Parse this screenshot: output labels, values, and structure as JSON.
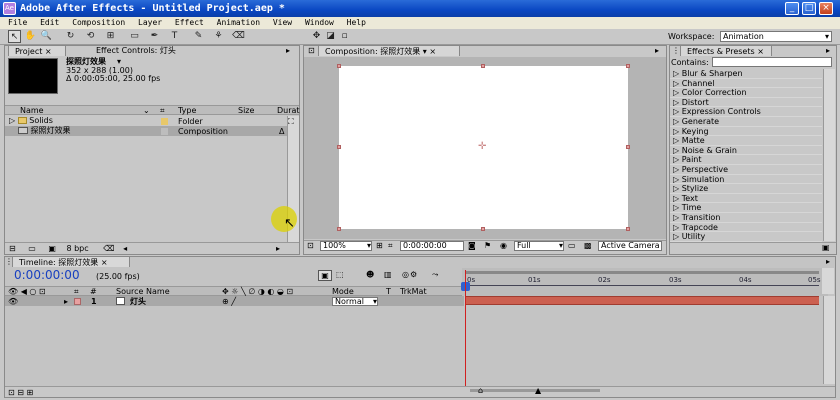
{
  "window": {
    "title": "Adobe After Effects - Untitled Project.aep *",
    "app_icon": "Ae",
    "buttons": {
      "minimize": "_",
      "maximize": "□",
      "close": "×"
    }
  },
  "menu": [
    "File",
    "Edit",
    "Composition",
    "Layer",
    "Effect",
    "Animation",
    "View",
    "Window",
    "Help"
  ],
  "toolbar": {
    "workspace_label": "Workspace:",
    "workspace_value": "Animation",
    "tools": [
      {
        "name": "selection-tool-icon",
        "glyph": "↖"
      },
      {
        "name": "hand-tool-icon",
        "glyph": "✋"
      },
      {
        "name": "zoom-tool-icon",
        "glyph": "🔍"
      },
      {
        "name": "rotate-tool-icon",
        "glyph": "↻"
      },
      {
        "name": "orbit-camera-icon",
        "glyph": "⟲"
      },
      {
        "name": "pan-behind-icon",
        "glyph": "⊞"
      },
      {
        "name": "mask-tool-icon",
        "glyph": "▭"
      },
      {
        "name": "pen-tool-icon",
        "glyph": "✒"
      },
      {
        "name": "type-tool-icon",
        "glyph": "T"
      },
      {
        "name": "brush-tool-icon",
        "glyph": "✎"
      },
      {
        "name": "clone-stamp-icon",
        "glyph": "⚘"
      },
      {
        "name": "eraser-icon",
        "glyph": "⌫"
      }
    ]
  },
  "project": {
    "tab_label": "Project",
    "tab2_label": "Effect Controls: 灯头",
    "item_name": "探照灯效果",
    "item_dims": "352 x 288 (1.00)",
    "item_duration": "Δ 0:00:05:00, 25.00 fps",
    "columns": {
      "name": "Name",
      "type": "Type",
      "size": "Size",
      "duration": "Durat"
    },
    "items": [
      {
        "name": "Solids",
        "type": "Folder",
        "label_color": "#e8c86a"
      },
      {
        "name": "探照灯效果",
        "type": "Composition",
        "label_color": "#bdbdbd",
        "extra": "Δ"
      }
    ],
    "bpc": "8 bpc"
  },
  "composition": {
    "tab_label": "Composition: 探照灯效果",
    "zoom": "100%",
    "timecode": "0:00:00:00",
    "resolution": "Full",
    "camera": "Active Camera",
    "canvas_color": "#ffffff"
  },
  "effects": {
    "tab_label": "Effects & Presets",
    "contains_label": "Contains:",
    "items": [
      "Blur & Sharpen",
      "Channel",
      "Color Correction",
      "Distort",
      "Expression Controls",
      "Generate",
      "Keying",
      "Matte",
      "Noise & Grain",
      "Paint",
      "Perspective",
      "Simulation",
      "Stylize",
      "Text",
      "Time",
      "Transition",
      "Trapcode",
      "Utility"
    ]
  },
  "timeline": {
    "tab_label": "Timeline: 探照灯效果",
    "timecode": "0:00:00:00",
    "fps": "(25.00 fps)",
    "columns": {
      "num": "#",
      "source": "Source Name",
      "mode": "Mode",
      "t": "T",
      "trkmat": "TrkMat"
    },
    "layers": [
      {
        "index": "1",
        "name": "灯头",
        "mode": "Normal",
        "label_color": "#e8a0a0"
      }
    ],
    "ruler": [
      "0s",
      "01s",
      "02s",
      "03s",
      "04s",
      "05s"
    ],
    "bar_color": "#cc6050",
    "cti_color": "#d02020"
  }
}
